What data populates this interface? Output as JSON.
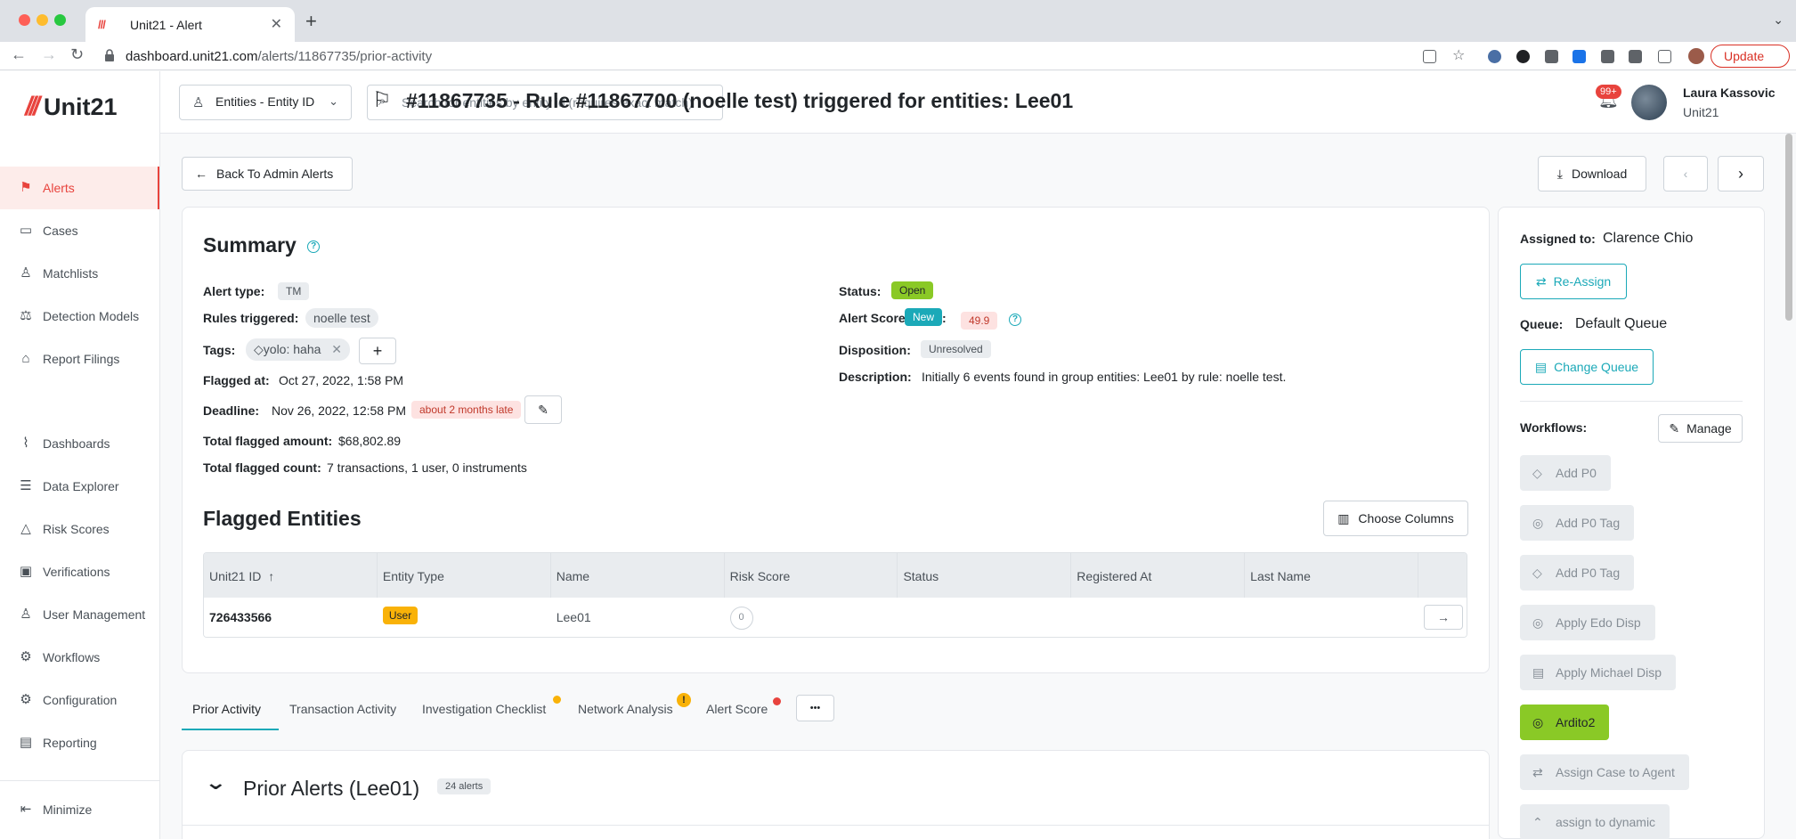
{
  "browser": {
    "tab_title": "Unit21 - Alert",
    "url_host": "dashboard.unit21.com",
    "url_path": "/alerts/11867735/prior-activity",
    "update_label": "Update"
  },
  "app": {
    "brand": "Unit21",
    "sidebar": {
      "items": [
        {
          "label": "Alerts",
          "icon": "flag-icon"
        },
        {
          "label": "Cases",
          "icon": "briefcase-icon"
        },
        {
          "label": "Matchlists",
          "icon": "user-check-icon"
        },
        {
          "label": "Detection Models",
          "icon": "scale-icon"
        },
        {
          "label": "Report Filings",
          "icon": "bank-icon"
        },
        {
          "label": "Dashboards",
          "icon": "chart-line-icon"
        },
        {
          "label": "Data Explorer",
          "icon": "document-search-icon"
        },
        {
          "label": "Risk Scores",
          "icon": "warning-icon"
        },
        {
          "label": "Verifications",
          "icon": "id-card-icon"
        },
        {
          "label": "User Management",
          "icon": "users-icon"
        },
        {
          "label": "Workflows",
          "icon": "gear-icon"
        },
        {
          "label": "Configuration",
          "icon": "settings-icon"
        },
        {
          "label": "Reporting",
          "icon": "clipboard-icon"
        }
      ],
      "minimize_label": "Minimize"
    },
    "header": {
      "entity_select": "Entities - Entity ID",
      "search_placeholder": "Search for entities by entity id (requires exact match)",
      "notif_count": "99+",
      "user_name": "Laura Kassovic",
      "user_org": "Unit21"
    }
  },
  "page": {
    "back_label": "Back To Admin Alerts",
    "title": "#11867735 - Rule #11867700 (noelle test) triggered for entities: Lee01",
    "download_label": "Download"
  },
  "summary": {
    "title": "Summary",
    "alert_type_label": "Alert type:",
    "alert_type": "TM",
    "rules_label": "Rules triggered:",
    "rules": "noelle test",
    "tags_label": "Tags:",
    "tag": "yolo: haha",
    "flagged_at_label": "Flagged at:",
    "flagged_at": "Oct 27, 2022, 1:58 PM",
    "deadline_label": "Deadline:",
    "deadline": "Nov 26, 2022, 12:58 PM",
    "deadline_late": "about 2 months late",
    "total_amount_label": "Total flagged amount:",
    "total_amount": "$68,802.89",
    "total_count_label": "Total flagged count:",
    "total_count": "7 transactions, 1 user, 0 instruments",
    "status_label": "Status:",
    "status": "Open",
    "alert_score_label": "Alert Score",
    "alert_score_new": "New",
    "alert_score_colon": ":",
    "alert_score": "49.9",
    "disposition_label": "Disposition:",
    "disposition": "Unresolved",
    "description_label": "Description:",
    "description": "Initially 6 events found in group entities: Lee01 by rule: noelle test."
  },
  "flagged_entities": {
    "title": "Flagged Entities",
    "choose_columns": "Choose Columns",
    "columns": [
      "Unit21 ID",
      "Entity Type",
      "Name",
      "Risk Score",
      "Status",
      "Registered At",
      "Last Name"
    ],
    "rows": [
      {
        "id": "726433566",
        "type": "User",
        "name": "Lee01",
        "risk": "0",
        "status": "",
        "registered": "",
        "last_name": ""
      }
    ]
  },
  "tabs": [
    "Prior Activity",
    "Transaction Activity",
    "Investigation Checklist",
    "Network Analysis",
    "Alert Score"
  ],
  "network_warn": "!",
  "more_label": "•••",
  "prior_alerts": {
    "title": "Prior Alerts (Lee01)",
    "count": "24 alerts"
  },
  "right_panel": {
    "assigned_label": "Assigned to:",
    "assigned_to": "Clarence Chio",
    "reassign": "Re-Assign",
    "queue_label": "Queue:",
    "queue": "Default Queue",
    "change_queue": "Change Queue",
    "workflows_label": "Workflows:",
    "manage": "Manage",
    "workflows": [
      "Add P0",
      "Add P0 Tag",
      "Add P0 Tag",
      "Apply Edo Disp",
      "Apply Michael Disp",
      "Ardito2",
      "Assign Case to Agent",
      "assign to dynamic"
    ]
  },
  "colors": {
    "brand": "#e8433d",
    "accent": "#1ba9b8",
    "success": "#8ac926"
  }
}
